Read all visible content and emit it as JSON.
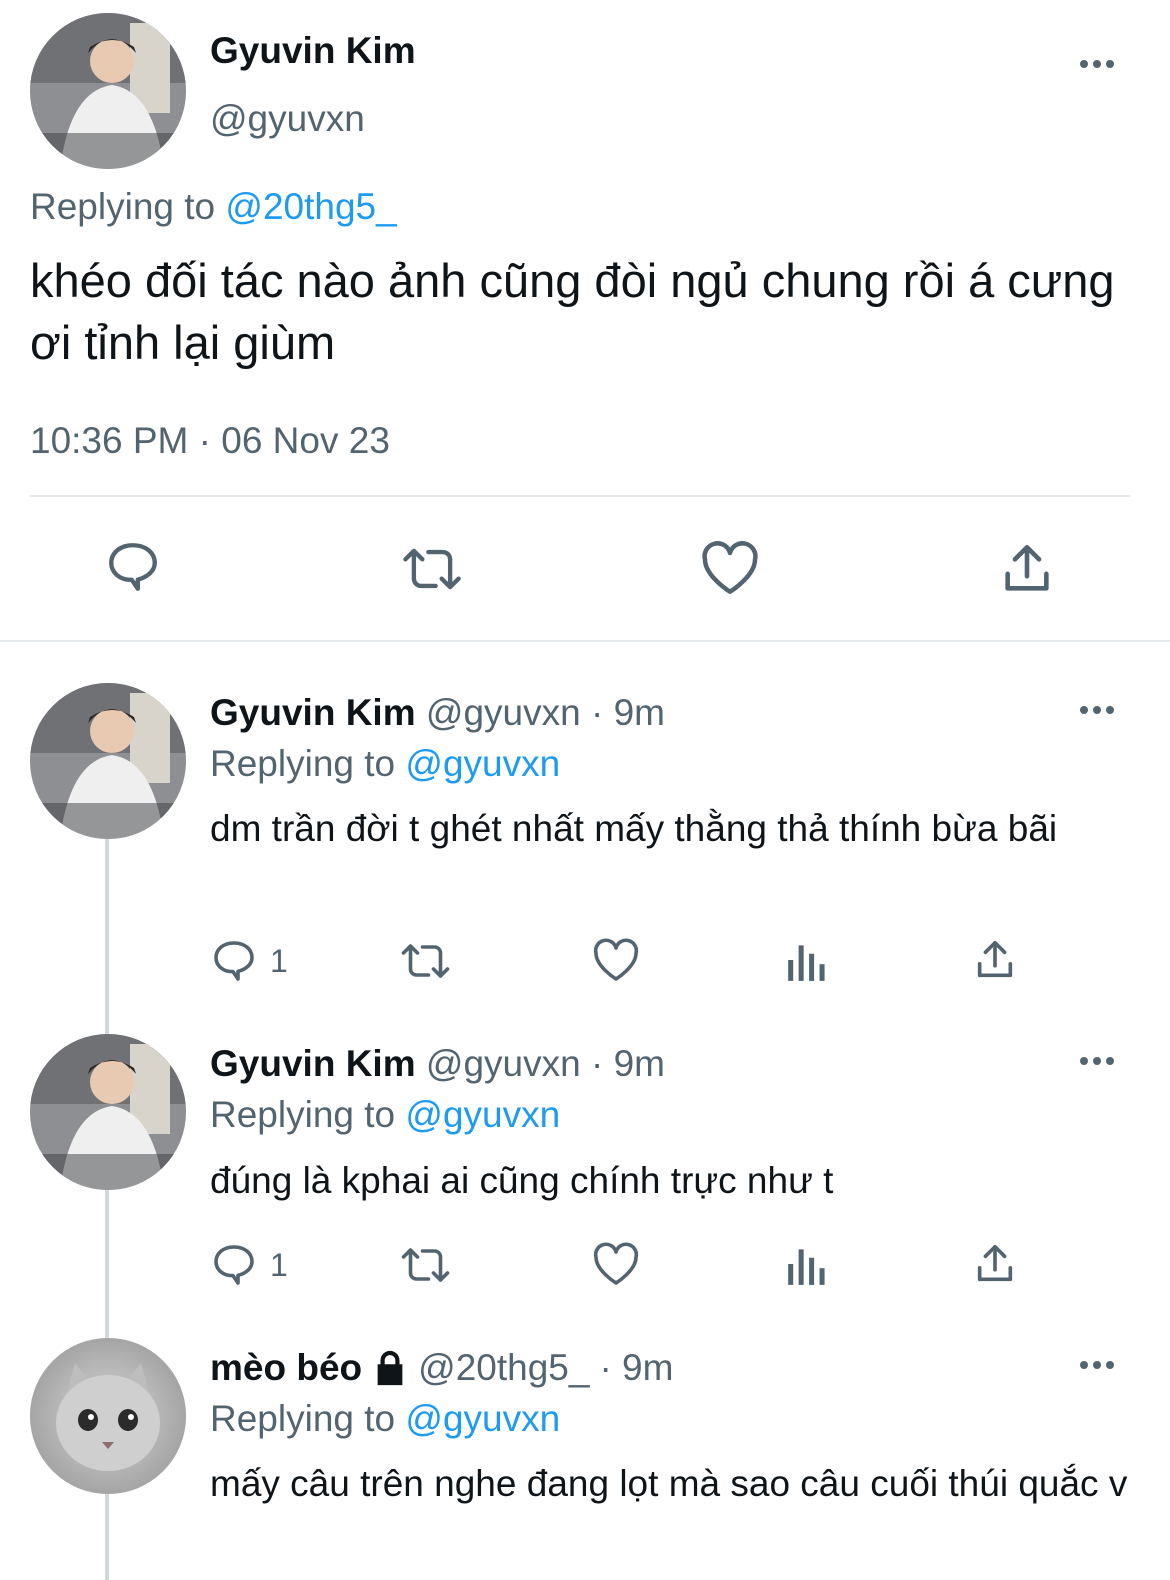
{
  "main_tweet": {
    "display_name": "Gyuvin Kim",
    "handle": "@gyuvxn",
    "replying_prefix": "Replying to",
    "replying_handle": "@20thg5_",
    "text": "khéo đối tác nào ảnh cũng đòi ngủ chung rồi á cưng ơi tỉnh lại giùm",
    "timestamp": "10:36 PM · 06 Nov 23",
    "actions": [
      "reply-icon",
      "retweet-icon",
      "like-icon",
      "share-icon"
    ]
  },
  "replies": [
    {
      "display_name": "Gyuvin Kim",
      "handle": "@gyuvxn",
      "time": "· 9m",
      "replying_prefix": "Replying to",
      "replying_handle": "@gyuvxn",
      "text": "dm trần đời t ghét nhất mấy thằng thả thính bừa bãi",
      "reply_count": "1"
    },
    {
      "display_name": "Gyuvin Kim",
      "handle": "@gyuvxn",
      "time": "· 9m",
      "replying_prefix": "Replying to",
      "replying_handle": "@gyuvxn",
      "text": "đúng là kphai ai cũng chính trực như t",
      "reply_count": "1"
    },
    {
      "display_name": "mèo béo",
      "handle": "@20thg5_",
      "time": "· 9m",
      "replying_prefix": "Replying to",
      "replying_handle": "@gyuvxn",
      "text": "mấy câu trên nghe đang lọt mà sao câu cuối thúi quắc v",
      "protected_icon": "lock-icon"
    }
  ],
  "colors": {
    "accent": "#1d9bf0",
    "muted": "#536471",
    "text": "#0f1419",
    "divider": "#e6e9eb"
  }
}
